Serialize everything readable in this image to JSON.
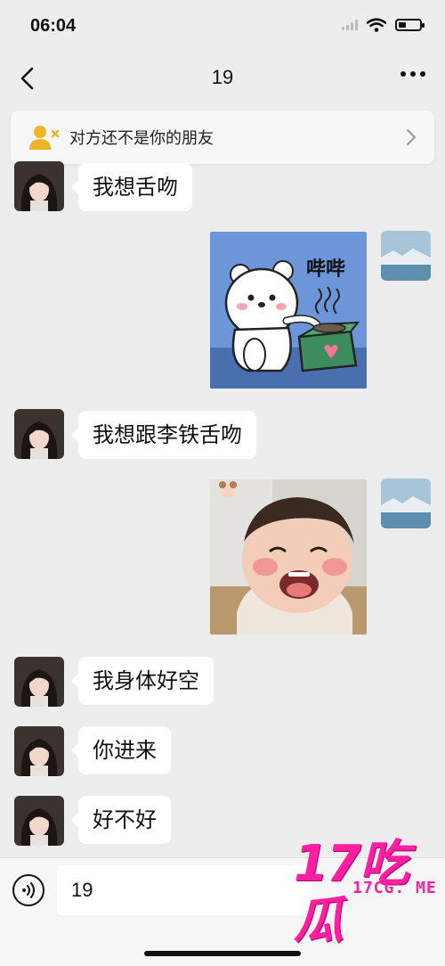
{
  "status_bar": {
    "time": "06:04"
  },
  "nav": {
    "title": "19"
  },
  "banner": {
    "text": "对方还不是你的朋友"
  },
  "messages": [
    {
      "side": "left",
      "type": "text",
      "text": "我想舌吻"
    },
    {
      "side": "right",
      "type": "sticker",
      "sticker": "polar-bear-sticker",
      "sticker_text": "哔哔"
    },
    {
      "side": "left",
      "type": "text",
      "text": "我想跟李铁舌吻"
    },
    {
      "side": "right",
      "type": "sticker",
      "sticker": "crying-baby-photo-sticker"
    },
    {
      "side": "left",
      "type": "text",
      "text": "我身体好空"
    },
    {
      "side": "left",
      "type": "text",
      "text": "你进来"
    },
    {
      "side": "left",
      "type": "text",
      "text": "好不好"
    }
  ],
  "input": {
    "value": "19"
  },
  "watermark": {
    "big": "17吃瓜",
    "small": "17CG. ME"
  },
  "colors": {
    "background": "#ededed",
    "bubble_left": "#ffffff",
    "banner_icon": "#f0b429",
    "watermark": "#ff1fa0"
  }
}
